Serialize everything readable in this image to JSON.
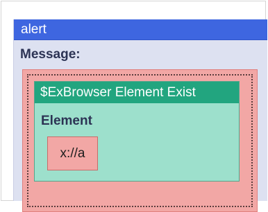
{
  "alert": {
    "title": "alert",
    "message_label": "Message:",
    "element_block": {
      "title": "$ExBrowser Element Exist",
      "element_label": "Element",
      "value": "x://a"
    }
  },
  "colors": {
    "alert_header": "#3e66e0",
    "alert_body": "#dde1f1",
    "slot": "#f2a7a5",
    "element_header": "#22a57f",
    "element_body": "#9de0cc"
  }
}
